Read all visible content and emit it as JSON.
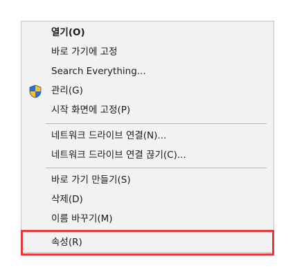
{
  "menu": {
    "items": [
      {
        "label": "열기(O)",
        "bold": true
      },
      {
        "label": "바로 가기에 고정"
      },
      {
        "label": "Search Everything..."
      },
      {
        "label": "관리(G)",
        "icon": "shield-icon"
      },
      {
        "label": "시작 화면에 고정(P)"
      },
      {
        "label": "네트워크 드라이브 연결(N)..."
      },
      {
        "label": "네트워크 드라이브 연결 끊기(C)..."
      },
      {
        "label": "바로 가기 만들기(S)"
      },
      {
        "label": "삭제(D)"
      },
      {
        "label": "이름 바꾸기(M)"
      },
      {
        "label": "속성(R)",
        "highlighted": true
      }
    ]
  },
  "colors": {
    "menu_background": "#f2f2f2",
    "highlight_border": "#e23a3a",
    "separator": "#b3b3b3",
    "shield_blue": "#2f6fc9",
    "shield_yellow": "#f2c12e"
  }
}
